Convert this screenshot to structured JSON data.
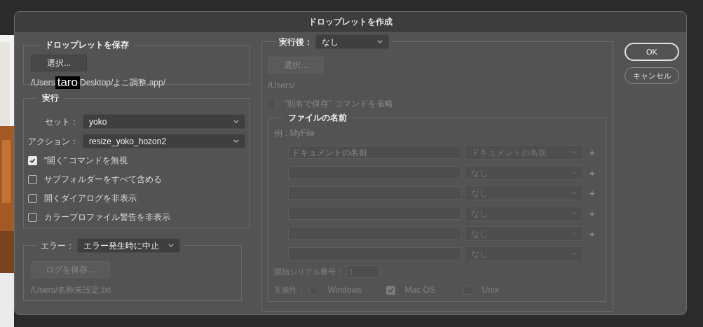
{
  "window": {
    "title": "ドロップレットを作成"
  },
  "save_group": {
    "legend": "ドロップレットを保存",
    "button": {
      "label": "選択...",
      "disabled": false
    },
    "path": {
      "before": "/Users",
      "redacted": "taro",
      "after": "Desktop/よこ調整.app/"
    }
  },
  "run_group": {
    "legend": "実行",
    "selects": [
      {
        "label": "セット：",
        "value": "yoko"
      },
      {
        "label": "アクション：",
        "value": "resize_yoko_hozon2"
      }
    ],
    "checkboxes": [
      {
        "label": "“開く” コマンドを無視",
        "checked": true
      },
      {
        "label": "サブフォルダーをすべて含める",
        "checked": false
      },
      {
        "label": "開くダイアログを非表示",
        "checked": false
      },
      {
        "label": "カラープロファイル警告を非表示",
        "checked": false
      }
    ]
  },
  "error_group": {
    "label": "エラー：",
    "value": "エラー発生時に中止",
    "button": {
      "label": "ログを保存...",
      "disabled": true
    },
    "path": {
      "text": "/Users/名称未設定.txt",
      "disabled": true
    }
  },
  "after_group": {
    "label": "実行後：",
    "value": "なし",
    "button": {
      "label": "選択...",
      "disabled": true
    },
    "path": {
      "text": "/Users/",
      "disabled": true
    },
    "checkbox": {
      "label": "“別名で保存” コマンドを省略",
      "checked": false,
      "disabled": true
    },
    "file_name": {
      "legend": "ファイルの名前",
      "example": "例 : MyFile",
      "disabled": true,
      "rows": [
        {
          "placeholder": "ドキュメントの名前",
          "value": "ドキュメントの名前",
          "add": "+"
        },
        {
          "value": "なし",
          "add": "+"
        },
        {
          "value": "なし",
          "add": "+"
        },
        {
          "value": "なし",
          "add": "+"
        },
        {
          "value": "なし",
          "add": "+"
        },
        {
          "value": "なし"
        }
      ],
      "serial": {
        "label": "開始シリアル番号：",
        "placeholder": "1"
      },
      "compat": {
        "label": "互換性：",
        "options": [
          {
            "label": "Windows",
            "checked": false
          },
          {
            "label": "Mac OS",
            "checked": true
          },
          {
            "label": "Unix",
            "checked": false
          }
        ]
      }
    }
  },
  "buttons": [
    {
      "label": "OK",
      "kind": "primary"
    },
    {
      "label": "キャンセル",
      "kind": "secondary"
    }
  ]
}
